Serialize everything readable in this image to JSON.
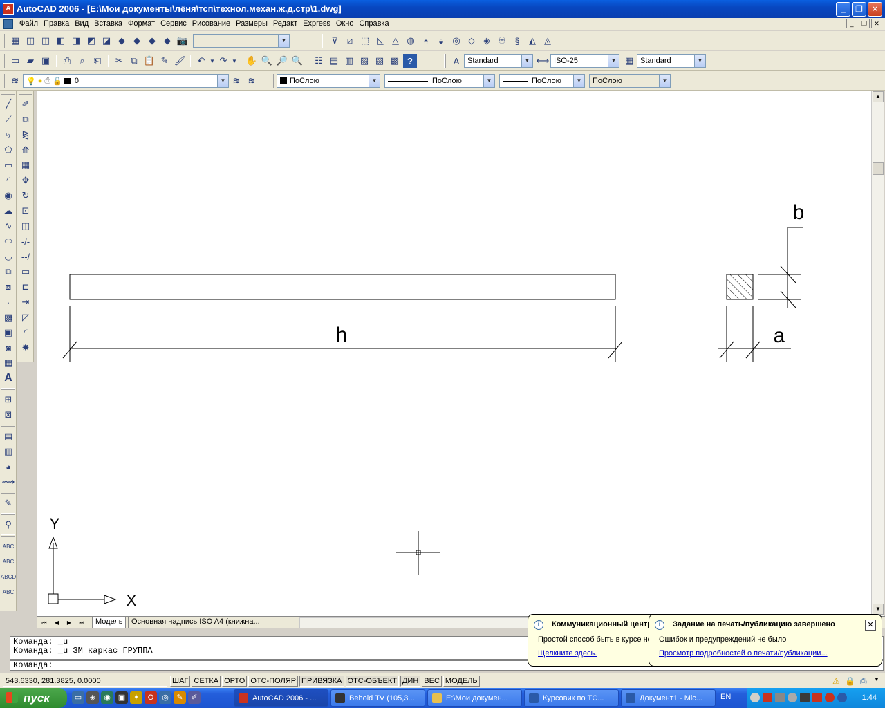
{
  "window": {
    "title": "AutoCAD 2006 - [E:\\Мои документы\\лёня\\тсп\\технол.механ.ж.д.стр\\1.dwg]"
  },
  "menu": [
    "Файл",
    "Правка",
    "Вид",
    "Вставка",
    "Формат",
    "Сервис",
    "Рисование",
    "Размеры",
    "Редакт",
    "Express",
    "Окно",
    "Справка"
  ],
  "toolbar": {
    "text_style": "Standard",
    "dim_style": "ISO-25",
    "table_style": "Standard",
    "layer": "0",
    "color": "ПоСлою",
    "linetype": "ПоСлою",
    "lineweight": "ПоСлою",
    "plotstyle": "ПоСлою"
  },
  "drawing": {
    "dim_h": "h",
    "dim_a": "a",
    "dim_b": "b",
    "ucs_x": "X",
    "ucs_y": "Y"
  },
  "tabs": {
    "model": "Модель",
    "layout": "Основная надпись ISO A4 (книжна..."
  },
  "command": {
    "history": [
      "Команда: _u",
      "Команда: _u ЗМ каркас ГРУППА"
    ],
    "prompt": "Команда:"
  },
  "status": {
    "coords": "543.6330, 281.3825, 0.0000",
    "buttons": [
      "ШАГ",
      "СЕТКА",
      "ОРТО",
      "ОТС-ПОЛЯР",
      "ПРИВЯЗКА",
      "ОТС-ОБЪЕКТ",
      "ДИН",
      "ВЕС",
      "МОДЕЛЬ"
    ]
  },
  "balloons": {
    "comm": {
      "title": "Коммуникационный центр",
      "body": "Простой способ быть в курсе новостей",
      "link": "Щелкните здесь."
    },
    "print": {
      "title": "Задание на печать/публикацию завершено",
      "body": "Ошибок и предупреждений не было",
      "link": "Просмотр подробностей о печати/публикации..."
    }
  },
  "taskbar": {
    "start": "пуск",
    "tasks": [
      "AutoCAD 2006 - ...",
      "Behold TV (105,3...",
      "E:\\Мои докумен...",
      "Курсовик по ТС...",
      "Документ1 - Mic..."
    ],
    "lang": "EN",
    "clock": "1:44"
  },
  "colors": {
    "titlebar": "#0847c0",
    "taskbar": "#245edb",
    "start": "#3ea53e"
  }
}
